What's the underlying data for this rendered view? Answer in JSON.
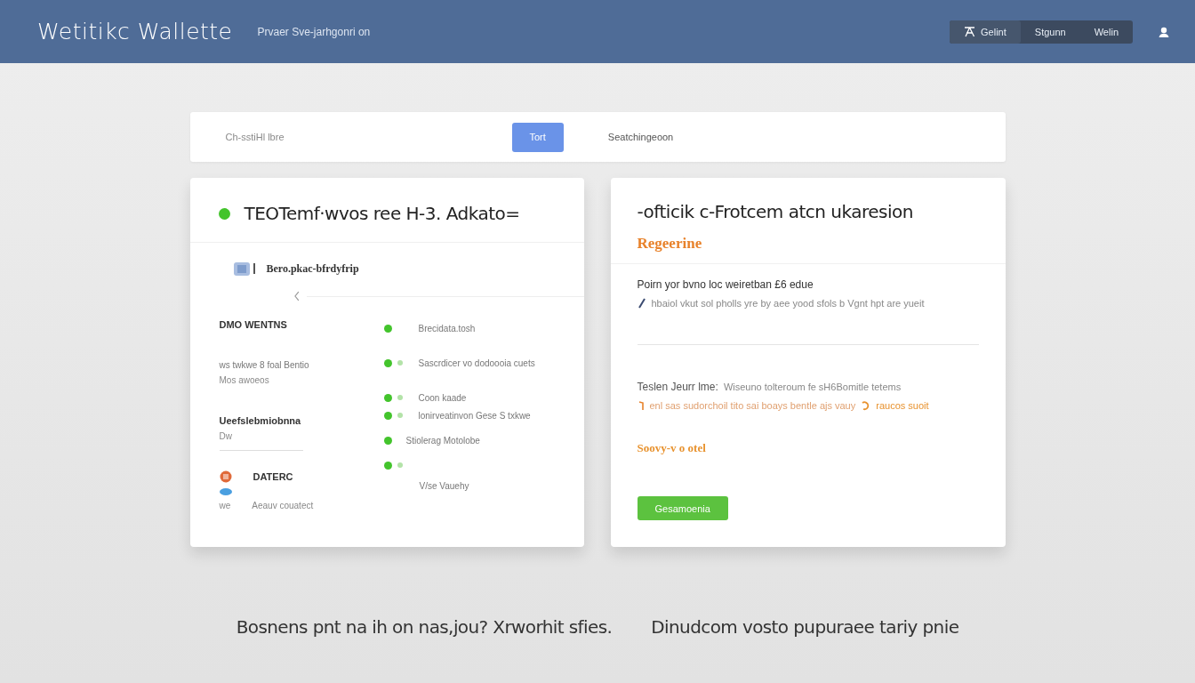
{
  "header": {
    "logo": "Wetitikc Wallette",
    "tagline": "Prvaer Sve-jarhgonri on",
    "nav": [
      {
        "label": "Gelint",
        "icon": true,
        "selected": true
      },
      {
        "label": "Stgunn",
        "icon": false,
        "selected": false
      },
      {
        "label": "Welin",
        "icon": false,
        "selected": false
      }
    ]
  },
  "search": {
    "placeholder": "Ch-sstiHl lbre",
    "button": "Tort",
    "hint": "Seatchingeoon"
  },
  "left_card": {
    "title": "TEOTemf·wvos ree H-3. Adkato=",
    "section": "Bero.pkac-bfrdyfrip",
    "labels": [
      {
        "kind": "heading",
        "title": "DMO WENTNS"
      },
      {
        "kind": "plain",
        "title": "ws twkwe 8 foal Bentio",
        "subtitle": "Mos awoeos"
      },
      {
        "kind": "heading",
        "title": "Ueefslebmiobnna",
        "subtitle": "Dw"
      },
      {
        "kind": "brand",
        "title": "DATERC",
        "prefix": "we",
        "subtitle": "Aeauv couatect"
      }
    ],
    "statuses": [
      {
        "kind": "single",
        "text": "Brecidata.tosh"
      },
      {
        "kind": "pair",
        "text": "Sascrdicer vo dodoooia cuets"
      },
      {
        "kind": "pair",
        "text": "Coon kaade"
      },
      {
        "kind": "pair",
        "text": "lonirveatinvon Gese S txkwe"
      },
      {
        "kind": "single",
        "text": "Stiolerag Motolobe"
      },
      {
        "kind": "pair"
      },
      {
        "kind": "blank",
        "text": "V/se Vauehy"
      }
    ]
  },
  "right_card": {
    "title": "-ofticik c-Frotcem atcn ukaresion",
    "subtitle": "Regeerine",
    "item_title": "Poirn yor bvno loc weiretban £6 edue",
    "item_text": "hbaiol vkut sol pholls yre by aee yood sfols b Vgnt hpt are yueit",
    "note_title": "Teslen Jeurr lme:",
    "note_text": "Wiseuno tolteroum fe sH6Bomitle tetems",
    "note_detail": "enl sas sudorchoil tito sai boays bentle ajs vauy",
    "note_link": "raucos suoit",
    "footer": "Soovy-v o otel",
    "button": "Gesamoenia"
  },
  "captions": [
    "Bosnens pnt na ih on nas,jou? Xrworhit sfies.",
    "Dinudcom vosto pupuraee tariy pnie"
  ]
}
